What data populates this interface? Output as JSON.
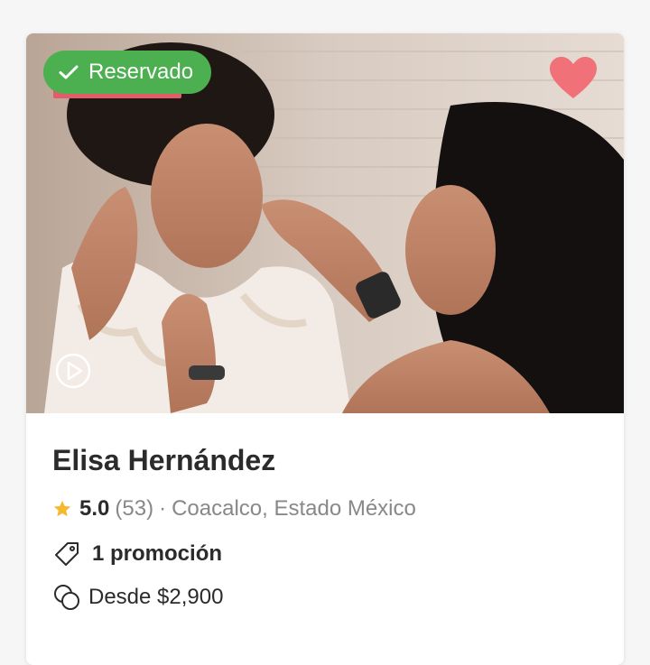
{
  "card": {
    "badge_label": "Reservado",
    "title": "Elisa Hernández",
    "rating": "5.0",
    "reviews": "(53)",
    "separator": "·",
    "location": "Coacalco, Estado México",
    "promotion": "1 promoción",
    "price": "Desde $2,900"
  },
  "icons": {
    "badge": "checkmark-icon",
    "favorite": "heart-icon",
    "video": "play-icon",
    "rating": "star-icon",
    "promotion": "tag-icon",
    "price": "coins-icon"
  },
  "colors": {
    "badge_green": "#4caf50",
    "heart_pink": "#f07178",
    "star_yellow": "#f5b82e",
    "text_dark": "#2b2b2b",
    "text_muted": "#888888"
  }
}
